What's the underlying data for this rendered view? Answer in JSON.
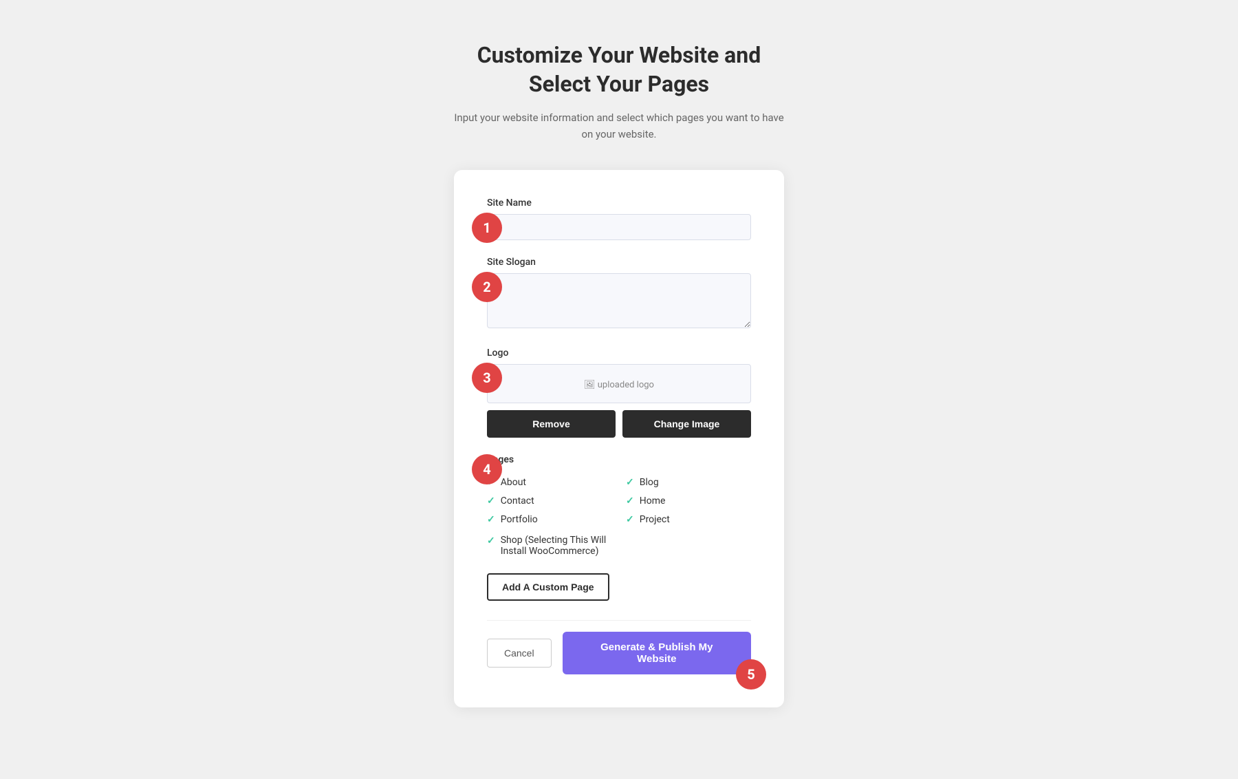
{
  "page": {
    "title_line1": "Customize Your Website and",
    "title_line2": "Select Your Pages",
    "subtitle": "Input your website information and select which pages you want to have on your website."
  },
  "form": {
    "site_name_label": "Site Name",
    "site_name_placeholder": "",
    "site_slogan_label": "Site Slogan",
    "site_slogan_placeholder": "",
    "logo_label": "Logo",
    "logo_preview_text": "uploaded logo",
    "remove_button": "Remove",
    "change_image_button": "Change Image",
    "pages_label": "Pages",
    "add_custom_page_button": "Add A Custom Page",
    "cancel_button": "Cancel",
    "publish_button": "Generate & Publish My Website"
  },
  "pages": [
    {
      "id": "about",
      "label": "About",
      "checked": true,
      "column": 1
    },
    {
      "id": "blog",
      "label": "Blog",
      "checked": true,
      "column": 2
    },
    {
      "id": "contact",
      "label": "Contact",
      "checked": true,
      "column": 1
    },
    {
      "id": "home",
      "label": "Home",
      "checked": true,
      "column": 2
    },
    {
      "id": "portfolio",
      "label": "Portfolio",
      "checked": true,
      "column": 1
    },
    {
      "id": "project",
      "label": "Project",
      "checked": true,
      "column": 2
    },
    {
      "id": "shop",
      "label": "Shop (Selecting This Will Install WooCommerce)",
      "checked": true,
      "column": 1
    }
  ],
  "steps": {
    "step1": "1",
    "step2": "2",
    "step3": "3",
    "step4": "4",
    "step5": "5"
  },
  "colors": {
    "badge_bg": "#e04444",
    "check_color": "#3cc8a0",
    "publish_bg": "#7b68ee"
  }
}
